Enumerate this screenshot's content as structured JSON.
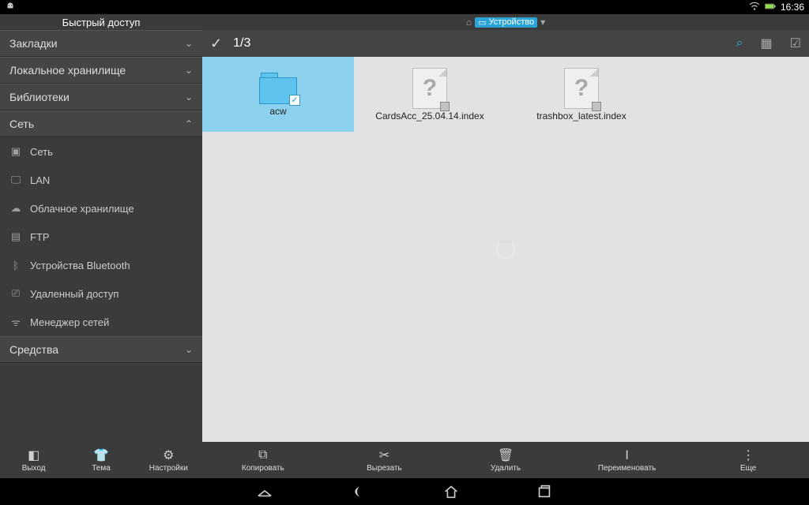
{
  "status": {
    "time": "16:36"
  },
  "breadcrumb": {
    "device": "Устройство"
  },
  "sidebar": {
    "title": "Быстрый доступ",
    "sections": {
      "bookmarks": "Закладки",
      "local": "Локальное хранилище",
      "libraries": "Библиотеки",
      "network": "Сеть",
      "tools": "Средства"
    },
    "network_items": {
      "net": "Сеть",
      "lan": "LAN",
      "cloud": "Облачное хранилище",
      "ftp": "FTP",
      "bluetooth": "Устройства Bluetooth",
      "remote": "Удаленный доступ",
      "netmgr": "Менеджер сетей"
    }
  },
  "selection": {
    "count": "1/3"
  },
  "files": {
    "0": {
      "name": "acw"
    },
    "1": {
      "name": "CardsAcc_25.04.14.index"
    },
    "2": {
      "name": "trashbox_latest.index"
    }
  },
  "actions": {
    "exit": "Выход",
    "theme": "Тема",
    "settings": "Настройки",
    "copy": "Копировать",
    "cut": "Вырезать",
    "delete": "Удалить",
    "rename": "Переименовать",
    "more": "Еще"
  }
}
